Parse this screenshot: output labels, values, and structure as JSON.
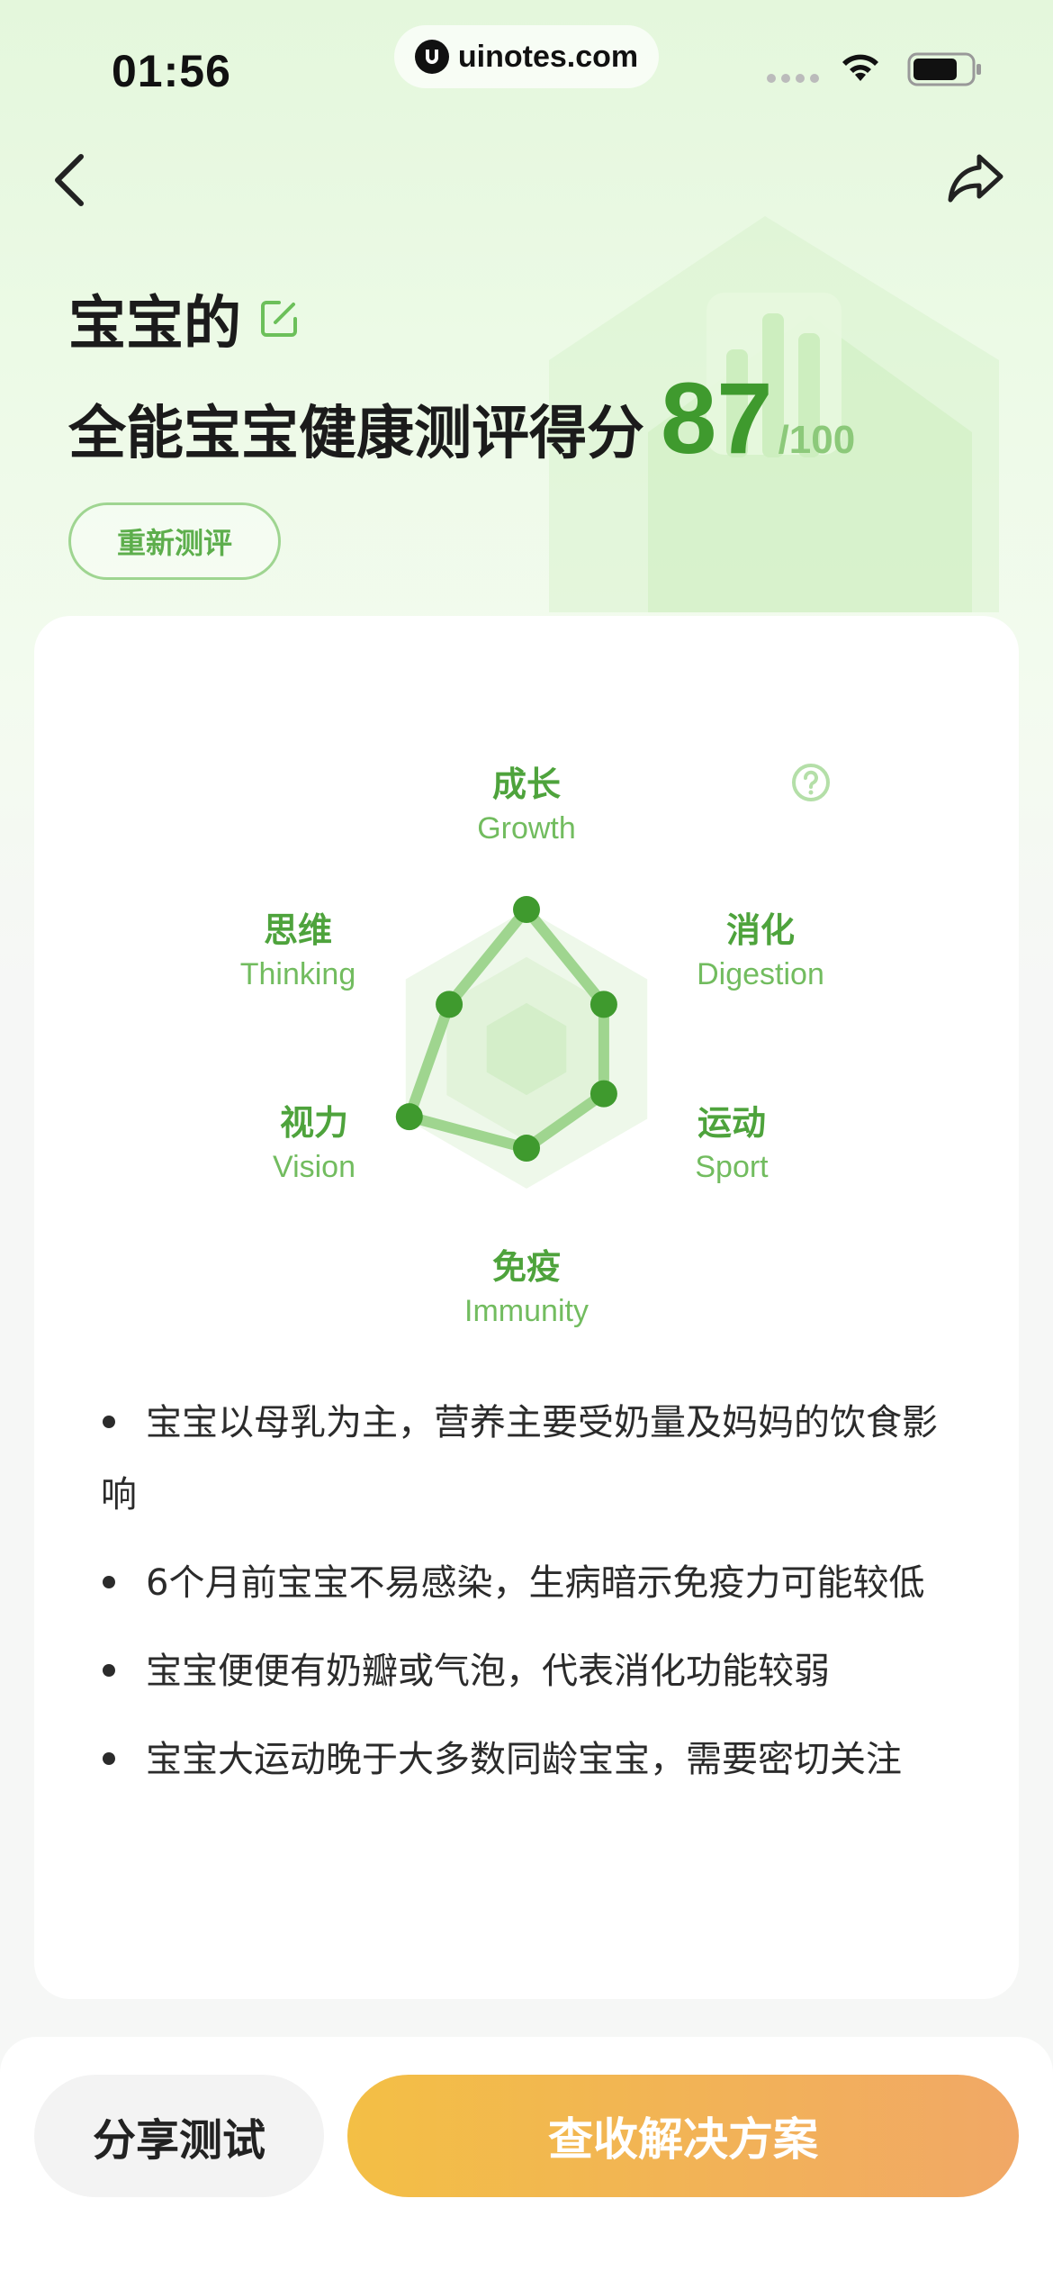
{
  "status_bar": {
    "time": "01:56",
    "url": "uinotes.com"
  },
  "header": {
    "title_line1": "宝宝的",
    "title_line2": "全能宝宝健康测评得分",
    "score": "87",
    "score_max": "/100",
    "retest_label": "重新测评"
  },
  "radar": {
    "axes": [
      {
        "cn": "成长",
        "en": "Growth"
      },
      {
        "cn": "消化",
        "en": "Digestion"
      },
      {
        "cn": "运动",
        "en": "Sport"
      },
      {
        "cn": "免疫",
        "en": "Immunity"
      },
      {
        "cn": "视力",
        "en": "Vision"
      },
      {
        "cn": "思维",
        "en": "Thinking"
      }
    ],
    "values": [
      1.0,
      0.64,
      0.64,
      0.71,
      0.97,
      0.64
    ],
    "colors": {
      "line": "#9fd58f",
      "dot": "#3f9a2e",
      "ring_outer": "#eef8ea",
      "ring_mid": "#e2f3da",
      "ring_inner": "#d4eec9"
    }
  },
  "bullets": [
    "宝宝以母乳为主，营养主要受奶量及妈妈的饮食影响",
    "6个月前宝宝不易感染，生病暗示免疫力可能较低",
    "宝宝便便有奶瓣或气泡，代表消化功能较弱",
    "宝宝大运动晚于大多数同龄宝宝，需要密切关注"
  ],
  "footer": {
    "share_label": "分享测试",
    "solution_label": "查收解决方案"
  },
  "colors": {
    "accent": "#3f9a2e",
    "button_gradient_start": "#f3bf45",
    "button_gradient_end": "#f1a866"
  }
}
